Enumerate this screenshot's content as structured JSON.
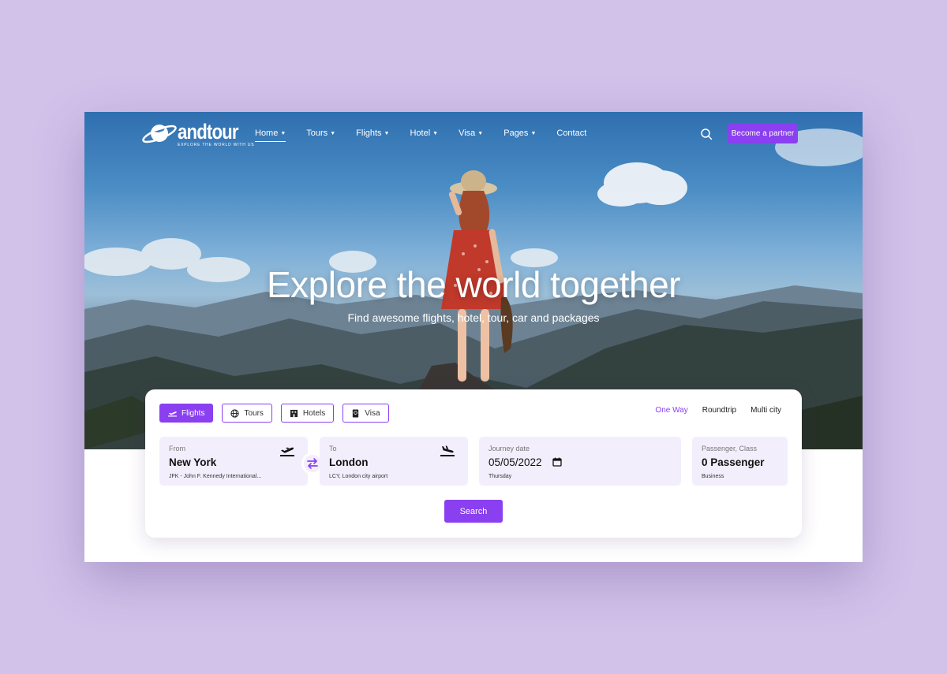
{
  "brand": {
    "name": "andtour",
    "tagline": "EXPLORE THE WORLD WITH US"
  },
  "nav": {
    "items": [
      {
        "label": "Home",
        "dropdown": true,
        "active": true
      },
      {
        "label": "Tours",
        "dropdown": true
      },
      {
        "label": "Flights",
        "dropdown": true
      },
      {
        "label": "Hotel",
        "dropdown": true
      },
      {
        "label": "Visa",
        "dropdown": true
      },
      {
        "label": "Pages",
        "dropdown": true
      },
      {
        "label": "Contact",
        "dropdown": false
      }
    ],
    "search_icon": "search-icon",
    "partner_label": "Become a partner"
  },
  "hero": {
    "title": "Explore the world together",
    "subtitle": "Find awesome flights, hotel, tour, car and packages"
  },
  "search": {
    "tabs": [
      {
        "label": "Flights",
        "icon": "plane-icon",
        "active": true
      },
      {
        "label": "Tours",
        "icon": "globe-icon"
      },
      {
        "label": "Hotels",
        "icon": "hotel-icon"
      },
      {
        "label": "Visa",
        "icon": "passport-icon"
      }
    ],
    "trip_types": [
      {
        "label": "One Way",
        "active": true
      },
      {
        "label": "Roundtrip"
      },
      {
        "label": "Multi city"
      }
    ],
    "from": {
      "label": "From",
      "value": "New York",
      "sub": "JFK - John F. Kennedy International..."
    },
    "to": {
      "label": "To",
      "value": "London",
      "sub": "LCY, London city airport"
    },
    "date": {
      "label": "Journey date",
      "value": "05/05/2022",
      "sub": "Thursday"
    },
    "passenger": {
      "label": "Passenger, Class",
      "value": "0 Passenger",
      "sub": "Business"
    },
    "button_label": "Search"
  },
  "colors": {
    "accent": "#8a3ff0",
    "field_bg": "#f3eefc",
    "page_bg": "#d2c2ea"
  }
}
